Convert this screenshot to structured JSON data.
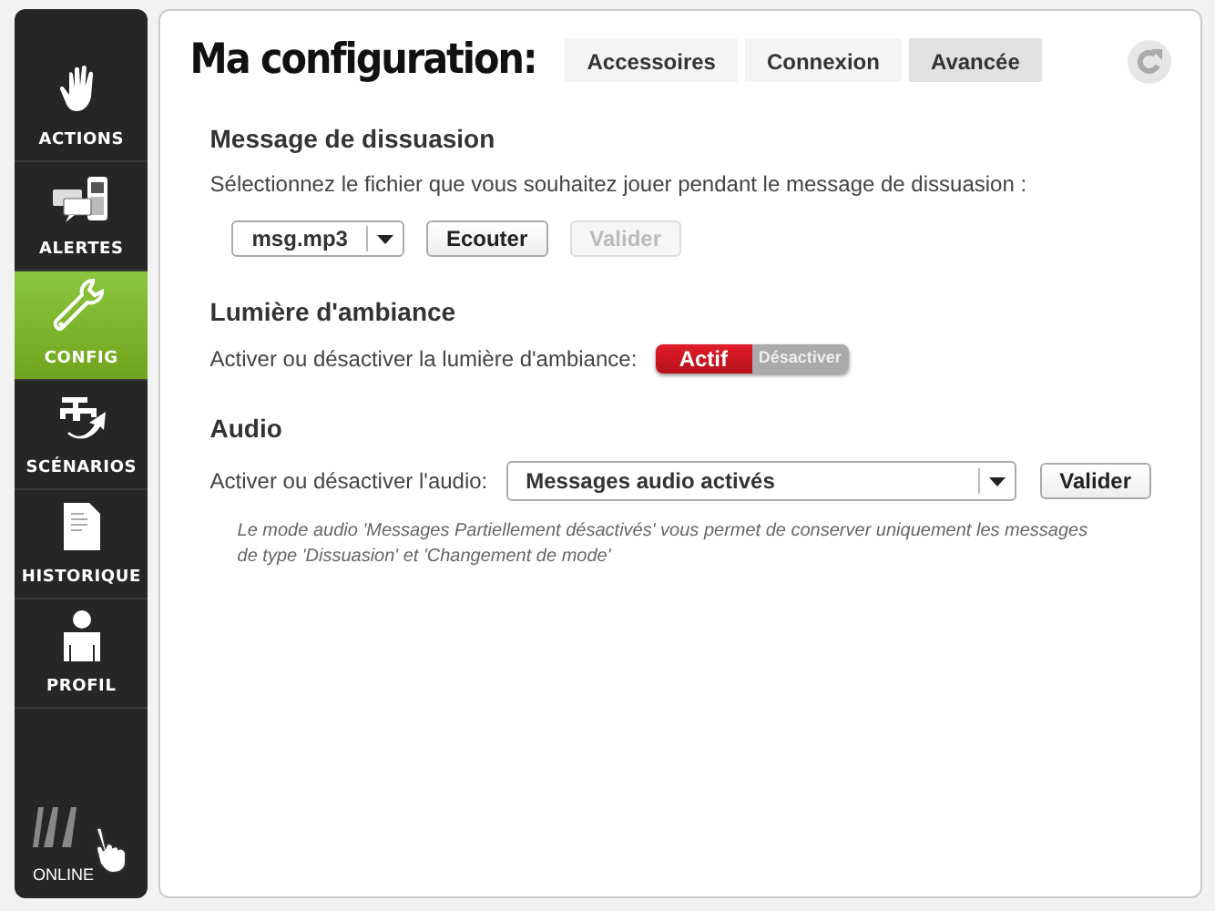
{
  "sidebar": {
    "items": [
      {
        "label": "ACTIONS",
        "selected": false
      },
      {
        "label": "ALERTES",
        "selected": false
      },
      {
        "label": "CONFIG",
        "selected": true
      },
      {
        "label": "SCÉNARIOS",
        "selected": false
      },
      {
        "label": "HISTORIQUE",
        "selected": false
      },
      {
        "label": "PROFIL",
        "selected": false
      }
    ],
    "logo": {
      "text": "ONLINE"
    }
  },
  "header": {
    "title": "Ma configuration:",
    "tabs": [
      {
        "label": "Accessoires",
        "selected": false
      },
      {
        "label": "Connexion",
        "selected": false
      },
      {
        "label": "Avancée",
        "selected": true
      }
    ]
  },
  "sections": [
    {
      "title": "Message de dissuasion",
      "description": "Sélectionnez le fichier que vous souhaitez jouer pendant le message de dissuasion :",
      "file_select": {
        "value": "msg.mp3"
      },
      "buttons": [
        {
          "label": "Ecouter",
          "disabled": false
        },
        {
          "label": "Valider",
          "disabled": true
        }
      ]
    },
    {
      "title": "Lumière d'ambiance",
      "label": "Activer ou désactiver la lumière d'ambiance:",
      "toggle": [
        {
          "label": "Actif",
          "selected": true
        },
        {
          "label": "Désactiver",
          "selected": false
        }
      ]
    },
    {
      "title": "Audio",
      "label": "Activer ou désactiver l'audio:",
      "audio_select": {
        "value": "Messages audio activés"
      },
      "buttons": [
        {
          "label": "Valider",
          "disabled": false
        }
      ],
      "note": "Le mode audio 'Messages Partiellement désactivés' vous permet de conserver uniquement les messages de type 'Dissuasion' et 'Changement de mode'"
    }
  ]
}
